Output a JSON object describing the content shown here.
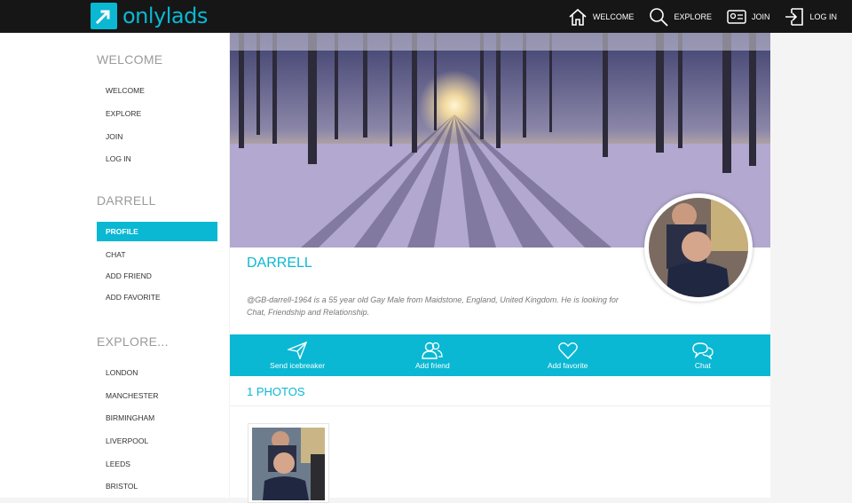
{
  "header": {
    "logo_text": "onlylads",
    "nav": [
      {
        "label": "WELCOME",
        "icon": "home-icon"
      },
      {
        "label": "EXPLORE",
        "icon": "search-icon"
      },
      {
        "label": "JOIN",
        "icon": "id-card-icon"
      },
      {
        "label": "LOG IN",
        "icon": "login-icon"
      }
    ]
  },
  "sidebar": {
    "welcome_heading": "WELCOME",
    "welcome_items": [
      "WELCOME",
      "EXPLORE",
      "JOIN",
      "LOG IN"
    ],
    "user_heading": "DARRELL",
    "user_items": [
      "PROFILE",
      "CHAT",
      "ADD FRIEND",
      "ADD FAVORITE"
    ],
    "explore_heading": "EXPLORE...",
    "explore_items": [
      "LONDON",
      "MANCHESTER",
      "BIRMINGHAM",
      "LIVERPOOL",
      "LEEDS",
      "BRISTOL"
    ]
  },
  "profile": {
    "name": "DARRELL",
    "description": "@GB-darrell-1964 is a 55 year old Gay Male from Maidstone, England, United Kingdom. He is looking for Chat, Friendship and Relationship."
  },
  "actions": [
    {
      "label": "Send icebreaker",
      "icon": "paper-plane-icon"
    },
    {
      "label": "Add friend",
      "icon": "add-friend-icon"
    },
    {
      "label": "Add favorite",
      "icon": "heart-icon"
    },
    {
      "label": "Chat",
      "icon": "chat-bubbles-icon"
    }
  ],
  "photos": {
    "heading": "1 PHOTOS"
  },
  "colors": {
    "accent": "#0ab8d3",
    "header_bg": "#161616"
  }
}
